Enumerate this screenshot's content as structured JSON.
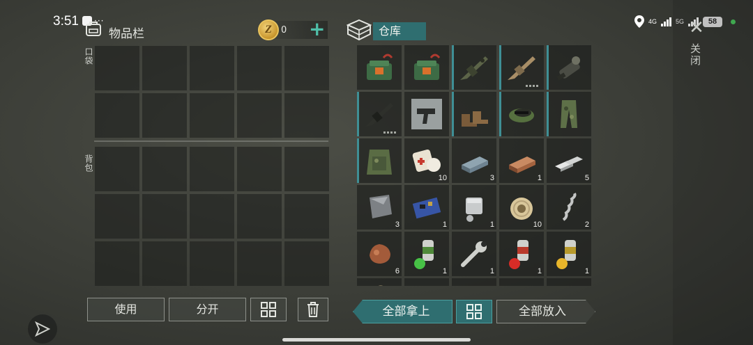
{
  "status": {
    "time": "3:51",
    "net1": "4G",
    "net2": "5G",
    "battery": "58"
  },
  "inventory": {
    "title": "物品栏",
    "coins": "0",
    "pocket_label": "口袋",
    "backpack_label": "背包"
  },
  "buttons": {
    "use": "使用",
    "split": "分开"
  },
  "storage": {
    "title": "仓库",
    "take_all": "全部拿上",
    "put_all": "全部放入"
  },
  "close_label": "关闭",
  "items": [
    {
      "icon": "medkit-box-icon",
      "qty": "",
      "equip": false
    },
    {
      "icon": "medkit-box-icon",
      "qty": "",
      "equip": false
    },
    {
      "icon": "assault-rifle-icon",
      "qty": "",
      "equip": true
    },
    {
      "icon": "tan-rifle-icon",
      "qty": "",
      "equip": true,
      "dur": true
    },
    {
      "icon": "minigun-icon",
      "qty": "",
      "equip": true
    },
    {
      "icon": "black-rifle-icon",
      "qty": "",
      "equip": true,
      "dur": true
    },
    {
      "icon": "smg-blueprint-icon",
      "qty": "",
      "equip": false
    },
    {
      "icon": "boots-icon",
      "qty": "",
      "equip": true
    },
    {
      "icon": "camo-cap-icon",
      "qty": "",
      "equip": true
    },
    {
      "icon": "camo-pants-icon",
      "qty": "",
      "equip": true
    },
    {
      "icon": "camo-vest-icon",
      "qty": "",
      "equip": true
    },
    {
      "icon": "bandage-icon",
      "qty": "10",
      "equip": false
    },
    {
      "icon": "steel-ingot-icon",
      "qty": "3",
      "equip": false
    },
    {
      "icon": "copper-ingot-icon",
      "qty": "1",
      "equip": false
    },
    {
      "icon": "silver-ingots-icon",
      "qty": "5",
      "equip": false
    },
    {
      "icon": "metal-plate-icon",
      "qty": "3",
      "equip": false
    },
    {
      "icon": "circuit-board-icon",
      "qty": "1",
      "equip": false
    },
    {
      "icon": "engine-part-icon",
      "qty": "1",
      "equip": false
    },
    {
      "icon": "wire-spool-icon",
      "qty": "10",
      "equip": false
    },
    {
      "icon": "spring-icon",
      "qty": "2",
      "equip": false
    },
    {
      "icon": "ore-lump-icon",
      "qty": "6",
      "equip": false
    },
    {
      "icon": "green-paint-icon",
      "qty": "1",
      "equip": false
    },
    {
      "icon": "wrench-icon",
      "qty": "1",
      "equip": false
    },
    {
      "icon": "red-paint-icon",
      "qty": "1",
      "equip": false
    },
    {
      "icon": "yellow-paint-icon",
      "qty": "1",
      "equip": false
    },
    {
      "icon": "partial-item-icon",
      "qty": "",
      "equip": false
    },
    {
      "icon": "",
      "qty": "",
      "equip": false
    },
    {
      "icon": "",
      "qty": "",
      "equip": false
    },
    {
      "icon": "",
      "qty": "",
      "equip": false
    },
    {
      "icon": "",
      "qty": "",
      "equip": false
    }
  ],
  "colors": {
    "accent": "#2f6e70",
    "accent_text": "#4fbfa9",
    "coin": "#e9c45e"
  }
}
